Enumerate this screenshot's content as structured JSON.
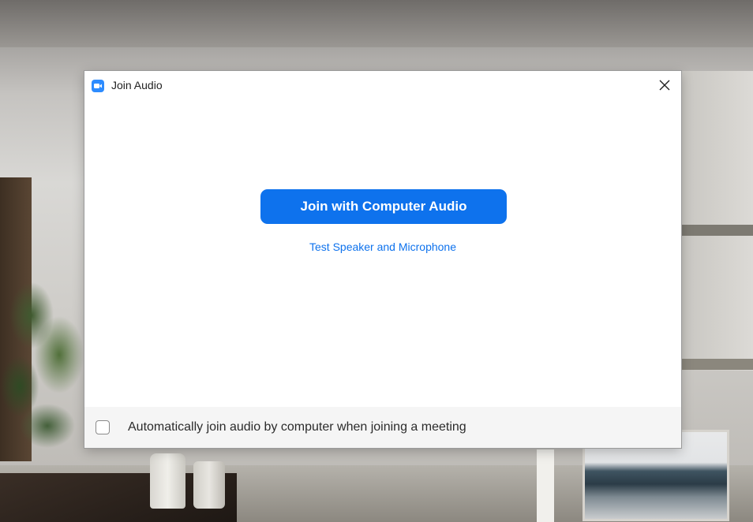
{
  "dialog": {
    "title": "Join Audio",
    "primary_button_label": "Join with Computer Audio",
    "test_link_label": "Test Speaker and Microphone",
    "auto_join_label": "Automatically join audio by computer when joining a meeting",
    "auto_join_checked": false
  },
  "icons": {
    "app": "zoom-camera-icon",
    "close": "close-icon"
  },
  "colors": {
    "accent": "#0e72ed",
    "app_icon": "#2d8cff",
    "footer_bg": "#f5f5f5"
  }
}
